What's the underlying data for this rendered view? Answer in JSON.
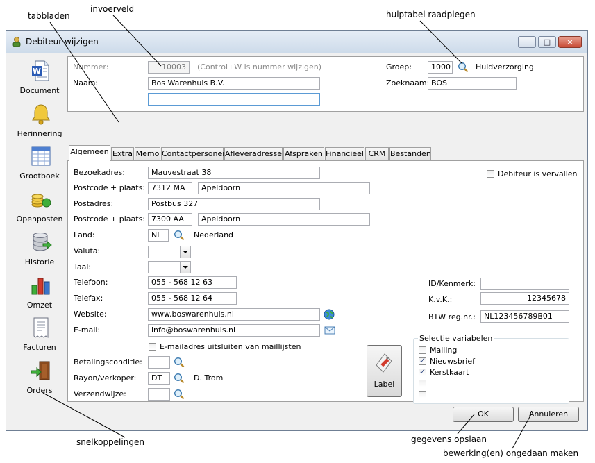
{
  "callouts": {
    "tabbladen": "tabbladen",
    "invoerveld": "invoerveld",
    "hulptabel": "hulptabel raadplegen",
    "snelkoppelingen": "snelkoppelingen",
    "opslaan": "gegevens opslaan",
    "ongedaan": "bewerking(en) ongedaan maken"
  },
  "window": {
    "title": "Debiteur wijzigen",
    "minimize": "−",
    "maximize": "□",
    "close": "×"
  },
  "sidebar": {
    "items": [
      {
        "label": "Document",
        "icon": "document-icon"
      },
      {
        "label": "Herinnering",
        "icon": "bell-icon"
      },
      {
        "label": "Grootboek",
        "icon": "ledger-icon"
      },
      {
        "label": "Openposten",
        "icon": "coins-icon"
      },
      {
        "label": "Historie",
        "icon": "database-icon"
      },
      {
        "label": "Omzet",
        "icon": "bar-chart-icon"
      },
      {
        "label": "Facturen",
        "icon": "invoice-icon"
      },
      {
        "label": "Orders",
        "icon": "door-icon"
      }
    ]
  },
  "header": {
    "nummer_label": "Nummer:",
    "nummer_value": "10003",
    "nummer_hint": "(Control+W is nummer wijzigen)",
    "naam_label": "Naam:",
    "naam_value": "Bos Warenhuis B.V.",
    "naam2_value": "",
    "groep_label": "Groep:",
    "groep_value": "1000",
    "groep_name": "Huidverzorging",
    "zoeknaam_label": "Zoeknaam:",
    "zoeknaam_value": "BOS"
  },
  "tabs": [
    "Algemeen",
    "Extra",
    "Memo",
    "Contactpersonen",
    "Afleveradressen",
    "Afspraken",
    "Financieel",
    "CRM",
    "Bestanden"
  ],
  "form": {
    "bezoekadres_label": "Bezoekadres:",
    "bezoekadres_value": "Mauvestraat 38",
    "postcode1_label": "Postcode + plaats:",
    "postcode1_value": "7312 MA",
    "plaats1_value": "Apeldoorn",
    "postadres_label": "Postadres:",
    "postadres_value": "Postbus 327",
    "postcode2_label": "Postcode + plaats:",
    "postcode2_value": "7300 AA",
    "plaats2_value": "Apeldoorn",
    "land_label": "Land:",
    "land_value": "NL",
    "land_name": "Nederland",
    "valuta_label": "Valuta:",
    "taal_label": "Taal:",
    "telefoon_label": "Telefoon:",
    "telefoon_value": "055 - 568 12 63",
    "telefax_label": "Telefax:",
    "telefax_value": "055 - 568 12 64",
    "website_label": "Website:",
    "website_value": "www.boswarenhuis.nl",
    "email_label": "E-mail:",
    "email_value": "info@boswarenhuis.nl",
    "email_exclude_label": "E-mailadres uitsluiten van maillijsten",
    "betaling_label": "Betalingsconditie:",
    "rayon_label": "Rayon/verkoper:",
    "rayon_value": "DT",
    "rayon_name": "D. Trom",
    "verzend_label": "Verzendwijze:",
    "vervallen_label": "Debiteur is vervallen",
    "id_label": "ID/Kenmerk:",
    "id_value": "",
    "kvk_label": "K.v.K.:",
    "kvk_value": "12345678",
    "btw_label": "BTW reg.nr.:",
    "btw_value": "NL123456789B01",
    "label_button": "Label"
  },
  "selectie": {
    "title": "Selectie variabelen",
    "items": [
      {
        "label": "Mailing",
        "checked": false
      },
      {
        "label": "Nieuwsbrief",
        "checked": true
      },
      {
        "label": "Kerstkaart",
        "checked": true
      },
      {
        "label": "",
        "checked": false
      },
      {
        "label": "",
        "checked": false
      }
    ]
  },
  "buttons": {
    "ok": "OK",
    "annuleren": "Annuleren"
  }
}
